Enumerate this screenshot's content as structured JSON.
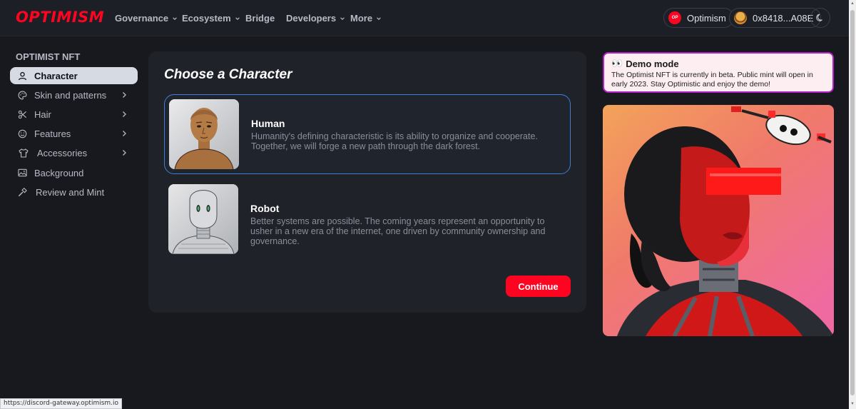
{
  "brand": {
    "logo_text": "OPTIMISM",
    "accent": "#ff0420"
  },
  "nav": {
    "items": [
      {
        "label": "Governance",
        "has_menu": true
      },
      {
        "label": "Ecosystem",
        "has_menu": true
      },
      {
        "label": "Bridge",
        "has_menu": false
      },
      {
        "label": "Developers",
        "has_menu": true
      },
      {
        "label": "More",
        "has_menu": true
      }
    ],
    "network": {
      "badge": "OP",
      "label": "Optimism"
    },
    "wallet": {
      "address": "0x8418...A08E"
    },
    "theme_icon": "moon-icon"
  },
  "sidebar": {
    "title": "OPTIMIST NFT",
    "items": [
      {
        "label": "Character",
        "icon": "user-icon",
        "active": true,
        "has_submenu": false
      },
      {
        "label": "Skin and patterns",
        "icon": "palette-icon",
        "active": false,
        "has_submenu": true
      },
      {
        "label": "Hair",
        "icon": "scissors-icon",
        "active": false,
        "has_submenu": true
      },
      {
        "label": "Features",
        "icon": "smile-icon",
        "active": false,
        "has_submenu": true
      },
      {
        "label": "Accessories",
        "icon": "shirt-icon",
        "active": false,
        "has_submenu": true
      },
      {
        "label": "Background",
        "icon": "image-icon",
        "active": false,
        "has_submenu": false
      },
      {
        "label": "Review and Mint",
        "icon": "hammer-icon",
        "active": false,
        "has_submenu": false
      }
    ]
  },
  "main": {
    "title": "Choose a Character",
    "options": [
      {
        "name": "Human",
        "description": "Humanity's defining characteristic is its ability to organize and cooperate. Together, we will forge a new path through the dark forest.",
        "selected": true
      },
      {
        "name": "Robot",
        "description": "Better systems are possible. The coming years represent an opportunity to usher in a new era of the internet, one driven by community ownership and governance.",
        "selected": false
      }
    ],
    "continue_label": "Continue"
  },
  "demo": {
    "emoji": "👀",
    "title": "Demo mode",
    "text": "The Optimist NFT is currently in beta. Public mint will open in early 2023. Stay Optimistic and enjoy the demo!"
  },
  "status_bar": {
    "url": "https://discord-gateway.optimism.io"
  }
}
